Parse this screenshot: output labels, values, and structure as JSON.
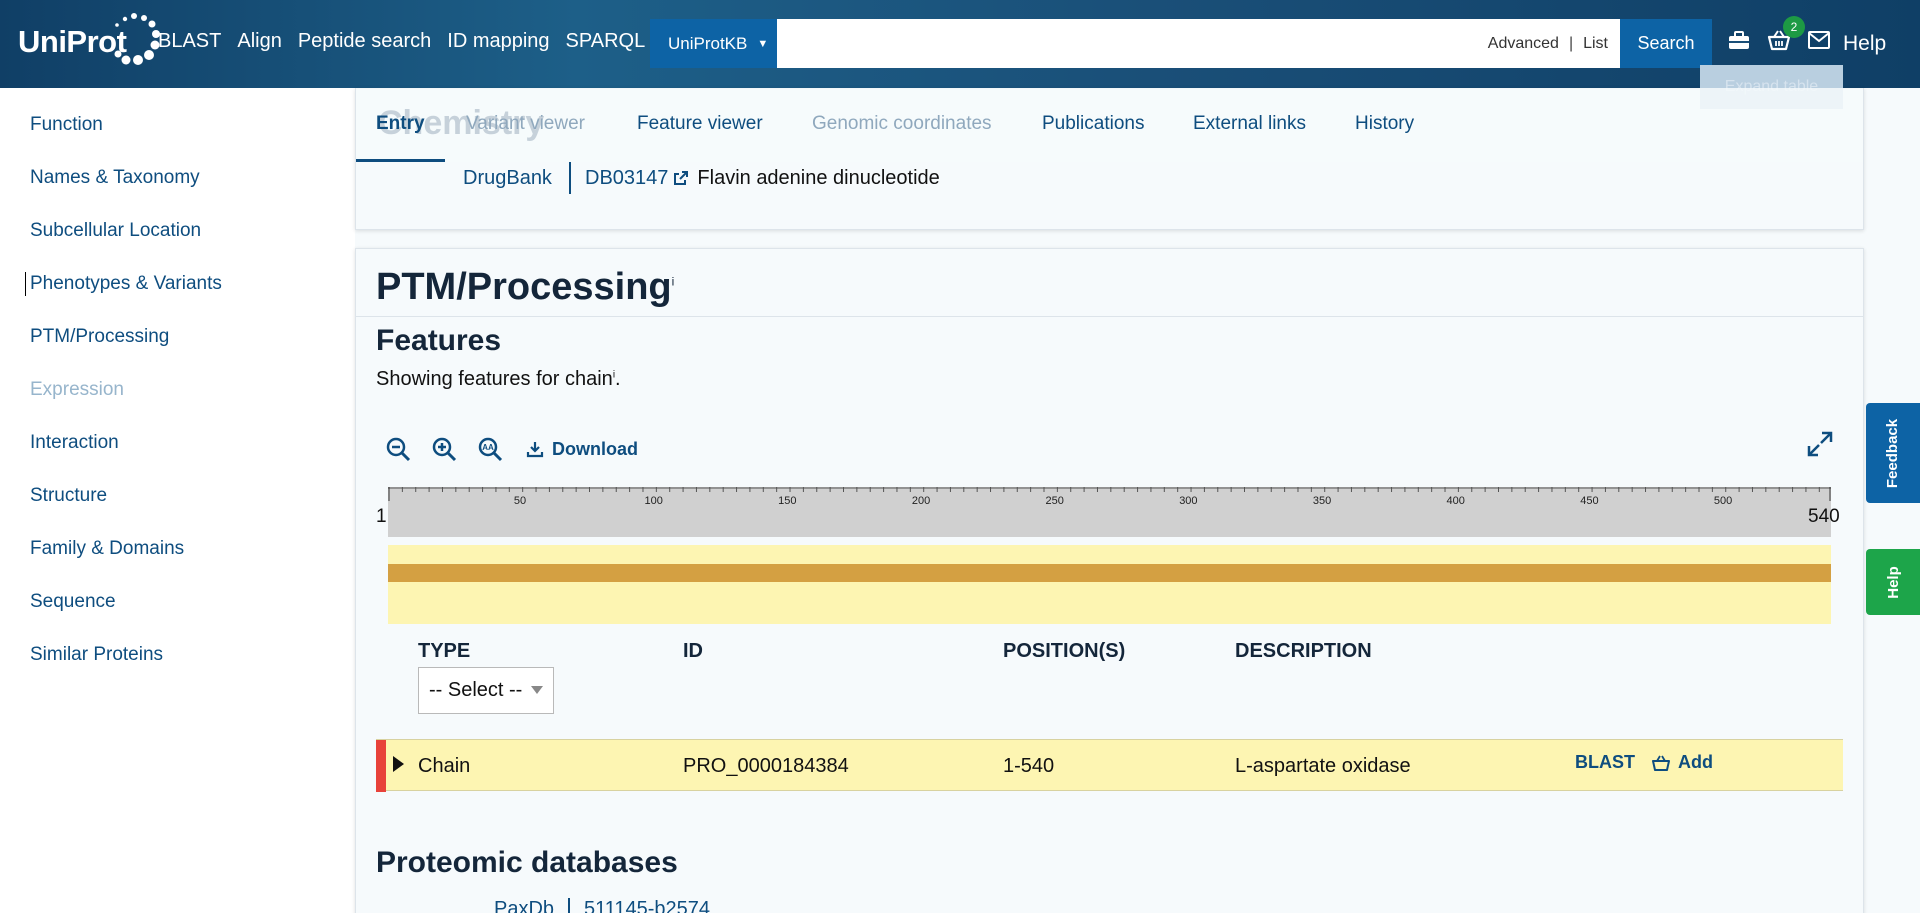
{
  "header": {
    "logo_text": "UniProt",
    "nav": [
      "BLAST",
      "Align",
      "Peptide search",
      "ID mapping",
      "SPARQL"
    ],
    "db_select": "UniProtKB",
    "search_placeholder": "",
    "advanced_label": "Advanced",
    "list_label": "List",
    "search_button": "Search",
    "basket_count": "2",
    "help_label": "Help",
    "icons": [
      "tools-icon",
      "basket-icon",
      "mail-icon"
    ]
  },
  "sidebar": {
    "items": [
      {
        "label": "Function",
        "state": "normal"
      },
      {
        "label": "Names & Taxonomy",
        "state": "normal"
      },
      {
        "label": "Subcellular Location",
        "state": "normal"
      },
      {
        "label": "Phenotypes & Variants",
        "state": "active"
      },
      {
        "label": "PTM/Processing",
        "state": "normal"
      },
      {
        "label": "Expression",
        "state": "disabled"
      },
      {
        "label": "Interaction",
        "state": "normal"
      },
      {
        "label": "Structure",
        "state": "normal"
      },
      {
        "label": "Family & Domains",
        "state": "normal"
      },
      {
        "label": "Sequence",
        "state": "normal"
      },
      {
        "label": "Similar Proteins",
        "state": "normal"
      }
    ]
  },
  "tabs": {
    "ghost_title": "Chemistry",
    "items": [
      {
        "label": "Entry",
        "state": "active"
      },
      {
        "label": "Variant viewer",
        "state": "muted"
      },
      {
        "label": "Feature viewer",
        "state": "normal"
      },
      {
        "label": "Genomic coordinates",
        "state": "muted"
      },
      {
        "label": "Publications",
        "state": "normal"
      },
      {
        "label": "External links",
        "state": "normal"
      },
      {
        "label": "History",
        "state": "normal"
      }
    ],
    "expand_button": "Expand table"
  },
  "chemistry": {
    "db_label": "DrugBank",
    "id": "DB03147",
    "description": "Flavin adenine dinucleotide"
  },
  "ptm": {
    "title": "PTM/Processing",
    "info_marker": "i",
    "features_title": "Features",
    "features_desc": "Showing features for chain",
    "features_desc_end": ".",
    "toolbar": {
      "download_label": "Download",
      "icons": [
        "zoom-out-icon",
        "zoom-in-icon",
        "text-zoom-icon",
        "download-icon",
        "fullscreen-icon"
      ]
    },
    "ruler": {
      "start": "1",
      "end": "540",
      "ticks": [
        "50",
        "100",
        "150",
        "200",
        "250",
        "300",
        "350",
        "400",
        "450",
        "500"
      ]
    },
    "table": {
      "headers": [
        "TYPE",
        "ID",
        "POSITION(S)",
        "DESCRIPTION"
      ],
      "type_filter": "-- Select --",
      "rows": [
        {
          "type": "Chain",
          "id": "PRO_0000184384",
          "positions": "1-540",
          "description": "L-aspartate oxidase",
          "blast": "BLAST",
          "add": "Add"
        }
      ]
    }
  },
  "proteomic": {
    "title": "Proteomic databases",
    "db_label": "PaxDb",
    "id": "511145-b2574"
  },
  "floating": {
    "feedback": "Feedback",
    "help": "Help"
  },
  "colors": {
    "header_bg": "#1a4f78",
    "link": "#0e4d7f",
    "accent_blue": "#0d63a5",
    "feature_track": "#d4a042",
    "feature_bg": "#fdf5b2",
    "row_flag": "#e8423a",
    "help_green": "#1da54a"
  }
}
